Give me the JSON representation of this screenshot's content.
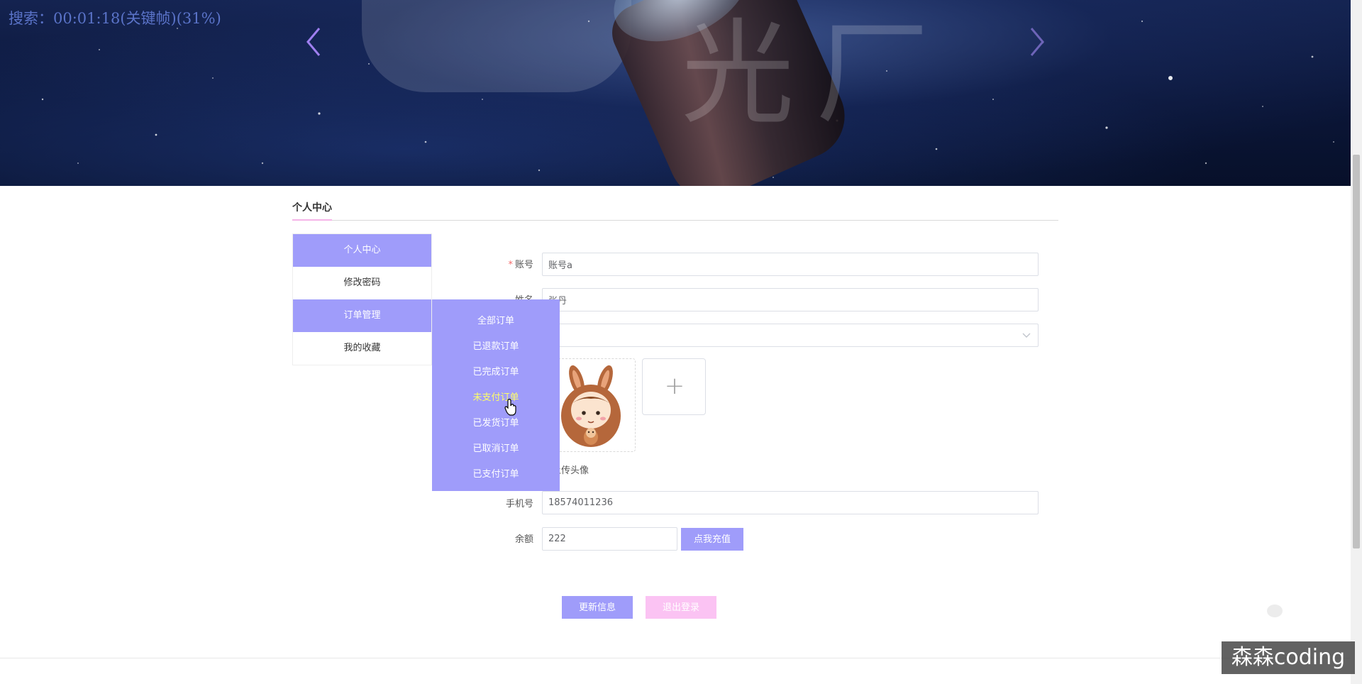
{
  "banner": {
    "search_status": "搜索：00:01:18(关键帧)(31%)",
    "logo_text": "光厂"
  },
  "section": {
    "title": "个人中心"
  },
  "side_menu": {
    "items": [
      {
        "label": "个人中心",
        "active": true
      },
      {
        "label": "修改密码",
        "active": false
      },
      {
        "label": "订单管理",
        "active": true
      },
      {
        "label": "我的收藏",
        "active": false
      }
    ]
  },
  "order_submenu": {
    "items": [
      {
        "label": "全部订单"
      },
      {
        "label": "已退款订单"
      },
      {
        "label": "已完成订单"
      },
      {
        "label": "未支付订单",
        "hovered": true
      },
      {
        "label": "已发货订单"
      },
      {
        "label": "已取消订单"
      },
      {
        "label": "已支付订单"
      }
    ]
  },
  "form": {
    "account_label": "账号",
    "account_value": "账号a",
    "name_label": "姓名",
    "name_value": "张丹",
    "gender_value": "",
    "upload_hint": "上传头像",
    "upload_plus": "+",
    "phone_label": "手机号",
    "phone_value": "18574011236",
    "balance_label": "余额",
    "balance_value": "222",
    "recharge_button": "点我充值"
  },
  "actions": {
    "update_button": "更新信息",
    "logout_button": "退出登录"
  },
  "watermark": "森森coding",
  "colors": {
    "primary": "#9f9cfa",
    "logout": "#fbc3f3",
    "accent_underline": "#f5b5e8",
    "hover_text": "#ffff66",
    "required": "#f56c6c"
  }
}
